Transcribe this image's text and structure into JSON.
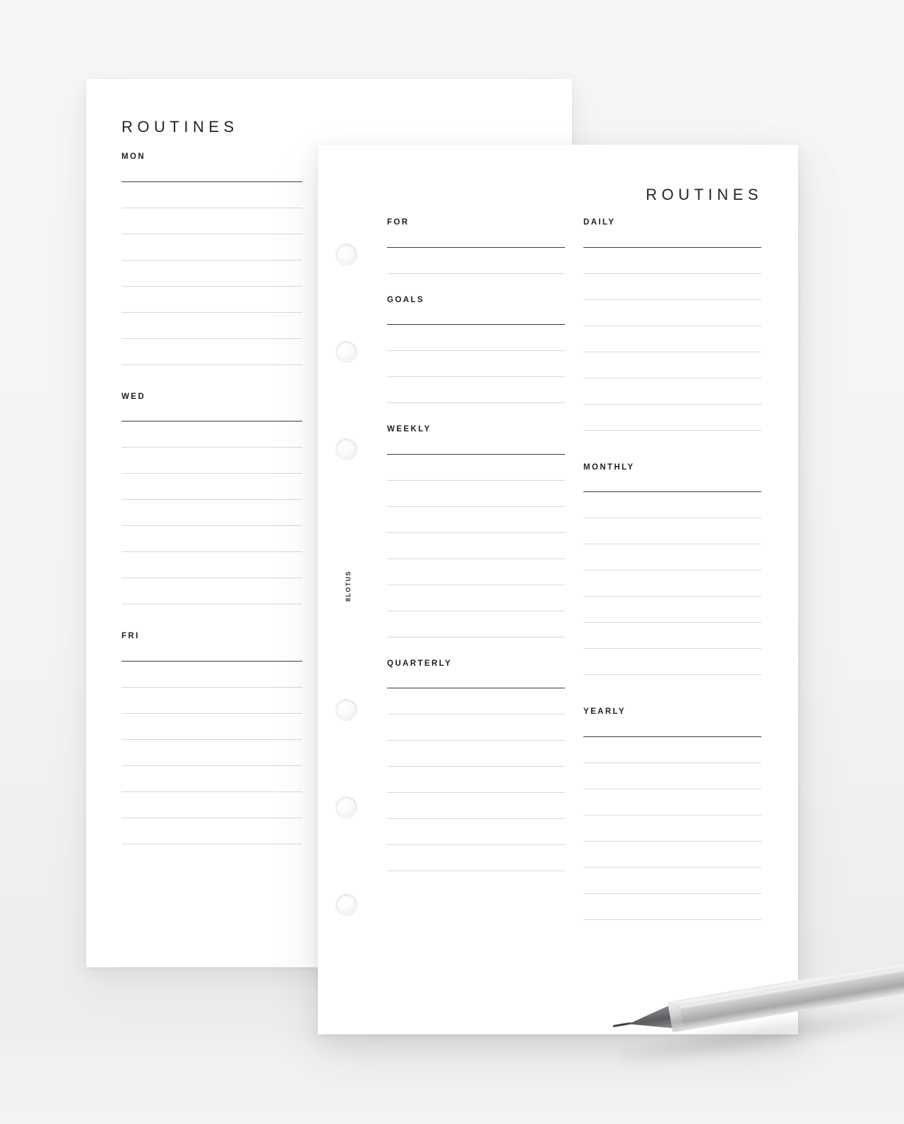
{
  "scene": {
    "background_color": "#f5f5f4",
    "paper_color": "#ffffff",
    "rule_color": "#d8d8d8",
    "primary_rule_color": "#3a3a3a",
    "text_color": "#1f1f1f"
  },
  "back_page": {
    "title": "ROUTINES",
    "sections": [
      {
        "label": "MON",
        "line_count": 8
      },
      {
        "label": "WED",
        "line_count": 8
      },
      {
        "label": "FRI",
        "line_count": 8
      }
    ]
  },
  "front_page": {
    "title": "ROUTINES",
    "brand_mark": "8LOTUS",
    "punch_holes": 6,
    "columns": {
      "left": [
        {
          "label": "FOR",
          "line_count": 2
        },
        {
          "label": "GOALS",
          "line_count": 4
        },
        {
          "label": "WEEKLY",
          "line_count": 8
        },
        {
          "label": "QUARTERLY",
          "line_count": 8
        }
      ],
      "right": [
        {
          "label": "DAILY",
          "line_count": 8
        },
        {
          "label": "MONTHLY",
          "line_count": 8
        },
        {
          "label": "YEARLY",
          "line_count": 8
        }
      ]
    }
  },
  "objects": [
    {
      "name": "mechanical-pencil",
      "color": "#bcbcbc",
      "tip_color": "#5a5c5f"
    }
  ]
}
